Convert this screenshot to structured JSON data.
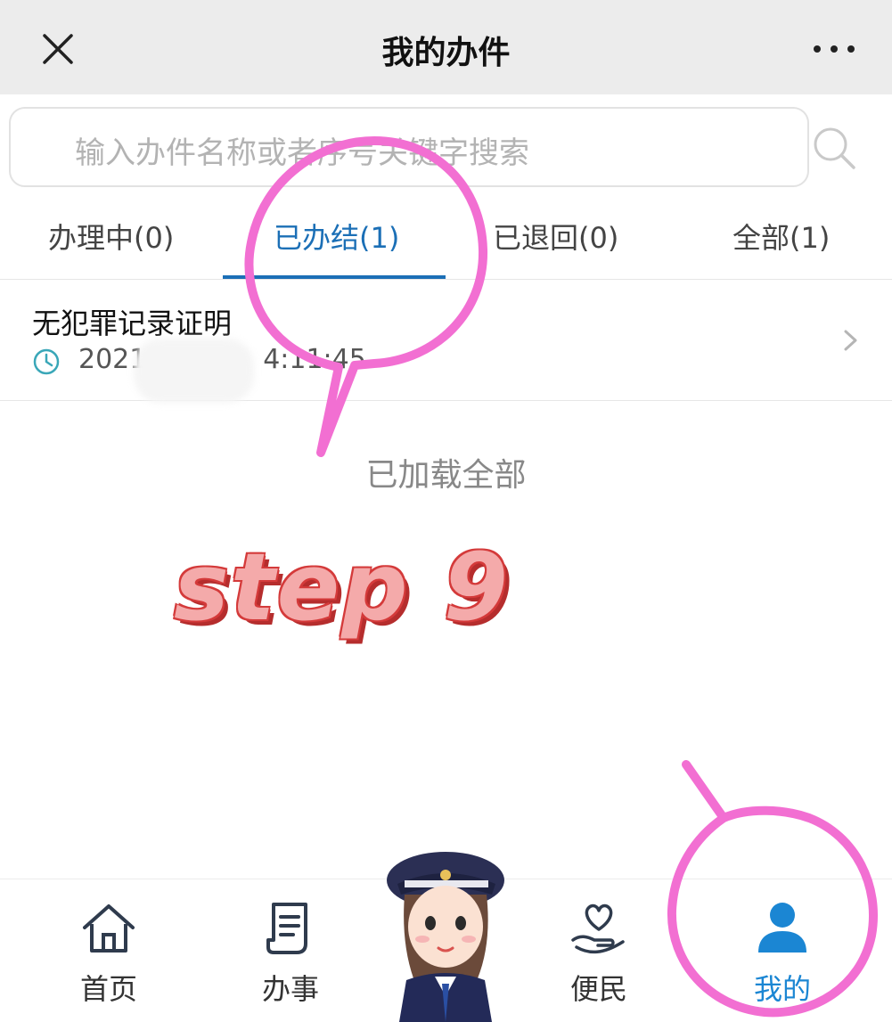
{
  "header": {
    "title": "我的办件",
    "close_icon": "close-icon",
    "more_icon": "more-icon"
  },
  "search": {
    "placeholder": "输入办件名称或者序号关键字搜索"
  },
  "tabs": [
    {
      "label": "办理中(0)",
      "active": false
    },
    {
      "label": "已办结(1)",
      "active": true
    },
    {
      "label": "已退回(0)",
      "active": false
    },
    {
      "label": "全部(1)",
      "active": false
    }
  ],
  "list": {
    "items": [
      {
        "title": "无犯罪记录证明",
        "time_prefix": "2021-",
        "time_suffix": "4:11:45"
      }
    ],
    "footer": "已加载全部"
  },
  "overlay": {
    "step_label": "step  9",
    "highlight_color": "#f26fd2"
  },
  "bottom_nav": [
    {
      "label": "首页",
      "icon": "home-icon",
      "active": false
    },
    {
      "label": "办事",
      "icon": "document-icon",
      "active": false
    },
    {
      "label": "便民",
      "icon": "heart-hand-icon",
      "active": false
    },
    {
      "label": "我的",
      "icon": "user-icon",
      "active": true
    }
  ],
  "colors": {
    "accent": "#1b6fb6",
    "active_nav": "#1b86d3",
    "header_bg": "#ececec"
  }
}
